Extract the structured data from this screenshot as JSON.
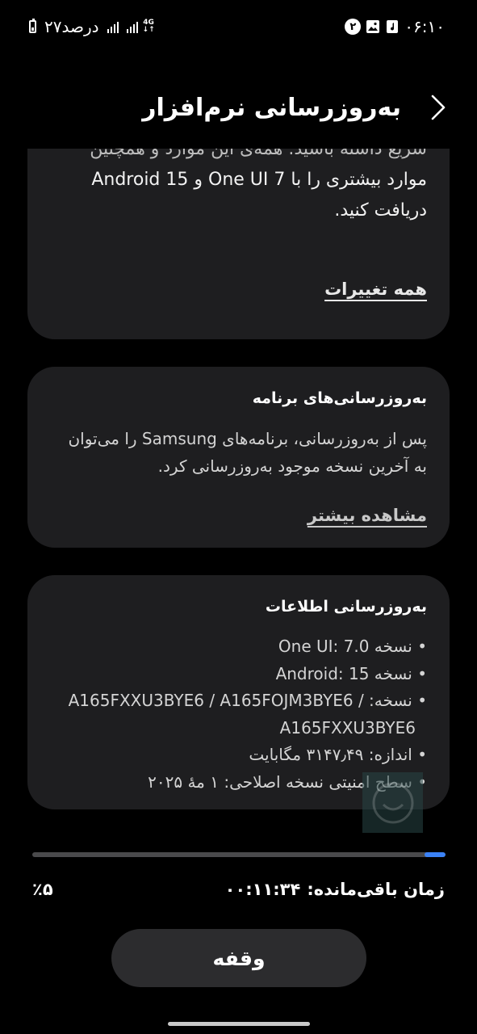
{
  "status_bar": {
    "time": "۰۶:۱۰",
    "notification_count": "۲",
    "battery_label": "۲۷درصد",
    "network_type": "4G"
  },
  "header": {
    "title": "به‌روزرسانی نرم‌افزار"
  },
  "changelog_card": {
    "cut_text": "سریع داشته باشید. همه‌ی این موارد و همچنین",
    "body_line_1": "موارد بیشتری را با One UI 7 و Android 15",
    "body_line_2": "دریافت کنید.",
    "link": "همه تغییرات"
  },
  "apps_card": {
    "title": "به‌روزرسانی‌های برنامه",
    "body": "پس از به‌روزرسانی، برنامه‌های Samsung را می‌توان به آخرین نسخه موجود به‌روزرسانی کرد.",
    "link": "مشاهده بیشتر"
  },
  "info_card": {
    "title": "به‌روزرسانی اطلاعات",
    "oneui_prefix": "نسخه ",
    "oneui_value": "One UI: 7.0",
    "android_prefix": "نسخه ",
    "android_value": "Android: 15",
    "build_prefix": "نسخه: ",
    "build_value_1": "A165FXXU3BYE6 / A165FOJM3BYE6 /",
    "build_value_2": "A165FXXU3BYE6",
    "size": "اندازه: ۳۱۴۷٫۴۹ مگابایت",
    "security_patch": "سطح امنیتی نسخه اصلاحی: ۱ مهٔ ۲۰۲۵"
  },
  "download": {
    "progress_fraction": 0.05,
    "percent_label": "٪۵",
    "time_label": "زمان باقی‌مانده:",
    "time_value": "۰۰:۱۱:۳۴"
  },
  "pause_button": {
    "label": "وقفه"
  },
  "colors": {
    "background": "#000000",
    "card": "#1e1e20",
    "accent": "#3b82f6",
    "track": "#4a4a4c"
  }
}
